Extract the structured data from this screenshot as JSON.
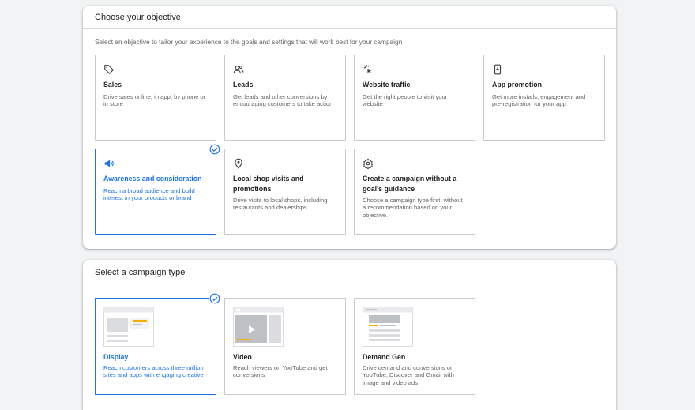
{
  "objective_section": {
    "title": "Choose your objective",
    "subtitle": "Select an objective to tailor your experience to the goals and settings that will work best for your campaign",
    "cards": [
      {
        "icon": "tag-icon",
        "title": "Sales",
        "desc": "Drive sales online, in app, by phone or in store",
        "selected": false
      },
      {
        "icon": "people-icon",
        "title": "Leads",
        "desc": "Get leads and other conversions by encouraging customers to take action",
        "selected": false
      },
      {
        "icon": "cursor-click-icon",
        "title": "Website traffic",
        "desc": "Get the right people to visit your website",
        "selected": false
      },
      {
        "icon": "phone-icon",
        "title": "App promotion",
        "desc": "Get more installs, engagement and pre-registration for your app",
        "selected": false
      },
      {
        "icon": "megaphone-icon",
        "title": "Awareness and consideration",
        "desc": "Reach a broad audience and build interest in your products or brand",
        "selected": true
      },
      {
        "icon": "location-pin-icon",
        "title": "Local shop visits and promotions",
        "desc": "Drive visits to local shops, including restaurants and dealerships.",
        "selected": false
      },
      {
        "icon": "gear-icon",
        "title": "Create a campaign without a goal's guidance",
        "desc": "Choose a campaign type first, without a recommendation based on your objective.",
        "selected": false
      }
    ]
  },
  "campaign_type_section": {
    "title": "Select a campaign type",
    "cards": [
      {
        "icon": "display-thumbnail",
        "title": "Display",
        "desc": "Reach customers across three million sites and apps with engaging creative",
        "selected": true
      },
      {
        "icon": "video-thumbnail",
        "title": "Video",
        "desc": "Reach viewers on YouTube and get conversions",
        "selected": false
      },
      {
        "icon": "demand-gen-thumbnail",
        "title": "Demand Gen",
        "desc": "Drive demand and conversions on YouTube, Discover and Gmail with image and video ads",
        "selected": false
      }
    ]
  },
  "colors": {
    "accent": "#1a73e8",
    "border": "#c8cacd",
    "background": "#f1f3f4"
  }
}
